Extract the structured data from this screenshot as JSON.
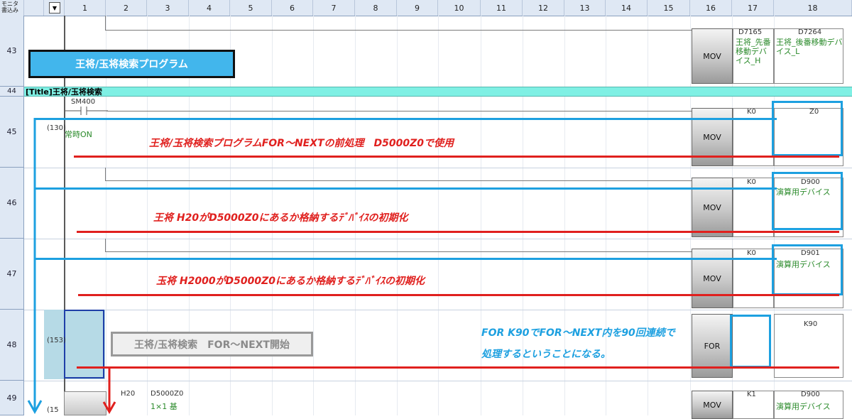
{
  "header": {
    "corner_label": "モニタ書込み",
    "columns": [
      "1",
      "2",
      "3",
      "4",
      "5",
      "6",
      "7",
      "8",
      "9",
      "10",
      "11",
      "12",
      "13",
      "14",
      "15",
      "16",
      "17",
      "18"
    ]
  },
  "rows": [
    {
      "num": "43"
    },
    {
      "num": "44"
    },
    {
      "num": "45"
    },
    {
      "num": "46"
    },
    {
      "num": "47"
    },
    {
      "num": "48"
    },
    {
      "num": "49"
    }
  ],
  "title_strip": "[Title]王将/玉将検索",
  "program_banner": "王将/玉将検索プログラム",
  "contact": {
    "name": "SM400",
    "comment": "常時ON"
  },
  "steps": {
    "r45": "(130)",
    "r48": "(153)",
    "r49": "(15"
  },
  "ladder": {
    "r43": {
      "instr": "MOV",
      "op1": "D7165",
      "op1_comment": "王将_先番移動デバイス_H",
      "op2": "D7264",
      "op2_comment": "王将_後番移動デバイス_L"
    },
    "r45": {
      "instr": "MOV",
      "op1": "K0",
      "op2": "Z0"
    },
    "r46": {
      "instr": "MOV",
      "op1": "K0",
      "op2": "D900",
      "op2_comment": "演算用デバイス"
    },
    "r47": {
      "instr": "MOV",
      "op1": "K0",
      "op2": "D901",
      "op2_comment": "演算用デバイス"
    },
    "r48": {
      "instr": "FOR",
      "op1": "K90"
    },
    "r49": {
      "instr": "MOV",
      "op1": "K1",
      "op2": "D900",
      "op2_comment": "演算用デバイス",
      "c1": "H20",
      "c2": "D5000Z0",
      "c2_comment": "1×1 基"
    }
  },
  "annotations": {
    "r45": "王将/玉将検索プログラムFOR～NEXTの前処理　D5000Z0で使用",
    "r46": "王将 H20がD5000Z0にあるか格納するﾃﾞﾊﾞｲｽの初期化",
    "r47": "玉将 H2000がD5000Z0にあるか格納するﾃﾞﾊﾞｲｽの初期化",
    "r48_label": "王将/玉将検索　FOR～NEXT開始",
    "r48_line1": "FOR K90でFOR～NEXT内を90回連続で",
    "r48_line2": "処理するということになる。"
  },
  "colors": {
    "accent_red": "#e0201e",
    "accent_blue": "#1da0e0",
    "title_strip": "#7ff0e4",
    "banner": "#42b6ec"
  }
}
